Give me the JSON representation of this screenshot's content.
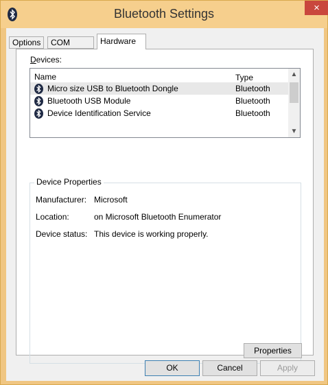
{
  "window": {
    "title": "Bluetooth Settings",
    "close_label": "×"
  },
  "tabs": [
    {
      "label": "Options"
    },
    {
      "label": "COM Ports"
    },
    {
      "label": "Hardware",
      "active": true
    }
  ],
  "devices": {
    "label_first": "D",
    "label_rest": "evices:",
    "columns": {
      "name": "Name",
      "type": "Type"
    },
    "rows": [
      {
        "name": "Micro size USB to Bluetooth Dongle",
        "type": "Bluetooth",
        "icon": "bluetooth-icon",
        "selected": true
      },
      {
        "name": "Bluetooth USB Module",
        "type": "Bluetooth",
        "icon": "bluetooth-icon"
      },
      {
        "name": "Device Identification Service",
        "type": "Bluetooth",
        "icon": "bluetooth-icon"
      }
    ]
  },
  "properties": {
    "group_title": "Device Properties",
    "manufacturer_label": "Manufacturer:",
    "manufacturer_value": "Microsoft",
    "location_label": "Location:",
    "location_value": "on Microsoft Bluetooth Enumerator",
    "status_label": "Device status:",
    "status_value": "This device is working properly.",
    "button_label": "Properties"
  },
  "buttons": {
    "ok": "OK",
    "cancel": "Cancel",
    "apply": "Apply"
  },
  "colors": {
    "titlebar": "#f6cf8d",
    "close": "#c9473d",
    "bluetooth": "#1f2a44"
  }
}
